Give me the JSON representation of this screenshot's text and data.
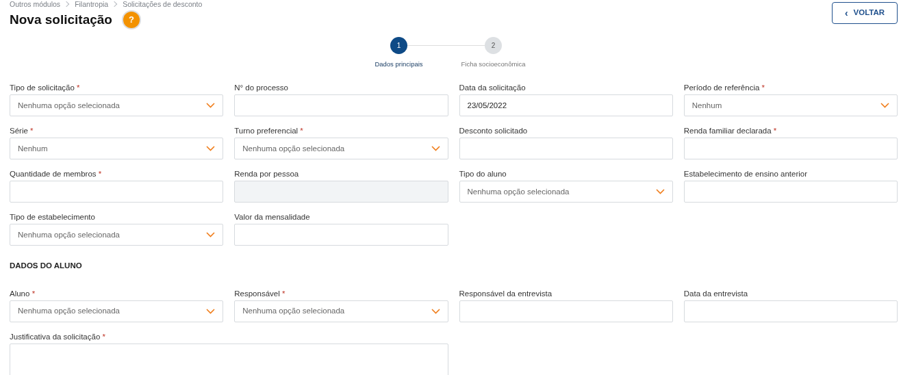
{
  "breadcrumb": [
    "Outros módulos",
    "Filantropia",
    "Solicitações de desconto"
  ],
  "title": "Nova solicitação",
  "help_icon": "?",
  "back_button": {
    "icon": "‹",
    "label": "VOLTAR"
  },
  "steps": [
    {
      "number": "1",
      "label": "Dados principais",
      "selected": true
    },
    {
      "number": "2",
      "label": "Ficha socioeconômica",
      "selected": false
    }
  ],
  "sections": [
    {
      "fields": [
        {
          "label": "Tipo de solicitação",
          "required_mark": "*",
          "kind": "select",
          "value": "Nenhuma opção selecionada"
        },
        {
          "label": "N° do processo",
          "kind": "text"
        },
        {
          "label": "Data da solicitação",
          "kind": "text",
          "value": "23/05/2022"
        },
        {
          "label": "Período de referência",
          "required_mark": "*",
          "kind": "select",
          "value": "Nenhum"
        },
        {
          "label": "Série",
          "required_mark": "*",
          "kind": "select",
          "value": "Nenhum"
        },
        {
          "label": "Turno preferencial",
          "required_mark": "*",
          "kind": "select",
          "value": "Nenhuma opção selecionada"
        },
        {
          "label": "Desconto solicitado",
          "kind": "text"
        },
        {
          "label": "Renda familiar declarada",
          "required_mark": "*",
          "kind": "text"
        },
        {
          "label": "Quantidade de membros",
          "required_mark": "*",
          "kind": "text"
        },
        {
          "label": "Renda por pessoa",
          "kind": "text",
          "disabled": true
        },
        {
          "label": "Tipo do aluno",
          "kind": "select",
          "value": "Nenhuma opção selecionada"
        },
        {
          "label": "Estabelecimento de ensino anterior",
          "kind": "text"
        },
        {
          "label": "Tipo de estabelecimento",
          "kind": "select",
          "value": "Nenhuma opção selecionada"
        },
        {
          "label": "Valor da mensalidade",
          "kind": "text"
        }
      ]
    },
    {
      "title": "DADOS DO ALUNO",
      "fields": [
        {
          "label": "Aluno",
          "required_mark": "*",
          "kind": "select",
          "value": "Nenhuma opção selecionada"
        },
        {
          "label": "Responsável",
          "required_mark": "*",
          "kind": "select",
          "value": "Nenhuma opção selecionada"
        },
        {
          "label": "Responsável da entrevista",
          "kind": "text"
        },
        {
          "label": "Data da entrevista",
          "kind": "text"
        },
        {
          "label": "Justificativa da solicitação",
          "required_mark": "*",
          "kind": "textarea"
        }
      ]
    }
  ]
}
